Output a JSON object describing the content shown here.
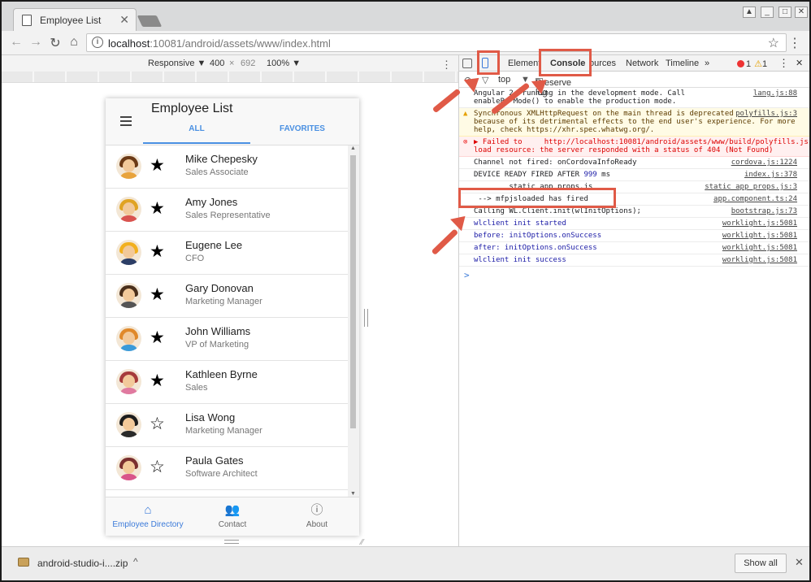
{
  "browser": {
    "tab_title": "Employee List",
    "tab_close": "✕",
    "url_host": "localhost",
    "url_rest": ":10081/android/assets/www/index.html"
  },
  "device_toolbar": {
    "mode": "Responsive ▼",
    "width": "400",
    "times": "×",
    "height": "692",
    "zoom": "100% ▼"
  },
  "app": {
    "title": "Employee List",
    "tabs": [
      "ALL",
      "FAVORITES"
    ],
    "employees": [
      {
        "name": "Mike Chepesky",
        "role": "Sales Associate",
        "favorite": true,
        "hair": "#6b3a16",
        "body": "#e8a33c"
      },
      {
        "name": "Amy Jones",
        "role": "Sales Representative",
        "favorite": true,
        "hair": "#e0a323",
        "body": "#d9534f"
      },
      {
        "name": "Eugene Lee",
        "role": "CFO",
        "favorite": true,
        "hair": "#f2b01e",
        "body": "#2c3e66"
      },
      {
        "name": "Gary Donovan",
        "role": "Marketing Manager",
        "favorite": true,
        "hair": "#4a2f1b",
        "body": "#555555"
      },
      {
        "name": "John Williams",
        "role": "VP of Marketing",
        "favorite": true,
        "hair": "#e0892a",
        "body": "#3a9ad9"
      },
      {
        "name": "Kathleen Byrne",
        "role": "Sales",
        "favorite": true,
        "hair": "#a63b3b",
        "body": "#e07aa0"
      },
      {
        "name": "Lisa Wong",
        "role": "Marketing Manager",
        "favorite": false,
        "hair": "#1d1d1d",
        "body": "#2a2a2a"
      },
      {
        "name": "Paula Gates",
        "role": "Software Architect",
        "favorite": false,
        "hair": "#7a2f2f",
        "body": "#d9558a"
      }
    ],
    "partial_row_name": "P..l.i...",
    "star_filled": "★",
    "star_empty": "☆",
    "bottom_nav": [
      {
        "label": "Employee Directory",
        "icon": "home-icon",
        "glyph": "⌂",
        "active": true
      },
      {
        "label": "Contact",
        "icon": "contacts-icon",
        "glyph": "👥",
        "active": false
      },
      {
        "label": "About",
        "icon": "info-icon",
        "glyph": "ⓘ",
        "active": false
      }
    ]
  },
  "devtools": {
    "tabs": [
      "Elements",
      "Console",
      "Sources",
      "Network",
      "Timeline",
      "»"
    ],
    "visible_tab_labels": [
      "Element",
      "Console",
      "ources",
      "Network",
      "Timeline",
      "»"
    ],
    "error_count": "1",
    "warning_count": "1",
    "context": "top",
    "preserve_log": "Preserve log",
    "logs": [
      {
        "type": "info",
        "text": "Angular 2 is running in the development mode. Call\nenableProdMode() to enable the production mode.",
        "visible_text": "Angular 2  running in the development mode. Call\nenableP  Mode() to enable the production mode.",
        "src": "lang.js:88"
      },
      {
        "type": "warn",
        "text": "Synchronous XMLHttpRequest on the main thread is deprecated\nbecause of its detrimental effects to the end user's experience. For more\nhelp, check https://xhr.spec.whatwg.org/.",
        "visible_text": "Synchronous XMLHttpRequest on the main thread is deprecated\nbecause of its detrimental effects to the end user's experience. For more\nhelp, check https://xhr.spec.whatwg.org/.",
        "src": "polyfills.js:3"
      },
      {
        "type": "error",
        "text": "▶ Failed to     http://localhost:10081/android/assets/www/build/polyfills.js\nload resource: the server responded with a status of 404 (Not Found)",
        "src": ""
      },
      {
        "type": "info",
        "text": "Channel not fired: onCordovaInfoReady",
        "src": "cordova.js:1224"
      },
      {
        "type": "info",
        "text": "DEVICE READY FIRED AFTER 999 ms",
        "src": "index.js:378"
      },
      {
        "type": "info",
        "text": "Running static_app_props.js",
        "visible_text": "        static_app_props.js",
        "src": "static_app_props.js:3"
      },
      {
        "type": "info",
        "text": " --> mfpjsloaded has fired",
        "src": "app.component.ts:24"
      },
      {
        "type": "info",
        "text": "Calling WL.Client.init(wlInitOptions);",
        "visible_text": "Calling WL.Client.init(wlInitOptions);",
        "src": "bootstrap.js:73"
      },
      {
        "type": "blue",
        "text": "wlclient init started",
        "src": "worklight.js:5081"
      },
      {
        "type": "blue",
        "text": "before: initOptions.onSuccess",
        "src": "worklight.js:5081"
      },
      {
        "type": "blue",
        "text": "after: initOptions.onSuccess",
        "src": "worklight.js:5081"
      },
      {
        "type": "blue",
        "text": "wlclient init success",
        "src": "worklight.js:5081"
      }
    ],
    "prompt": ">"
  },
  "downloads": {
    "file": "android-studio-i....zip",
    "chevron": "^",
    "show_all": "Show all",
    "close": "✕"
  },
  "colors": {
    "callout": "#e05a47",
    "accent": "#4a90e2",
    "console_blue": "#1a1aa6"
  }
}
